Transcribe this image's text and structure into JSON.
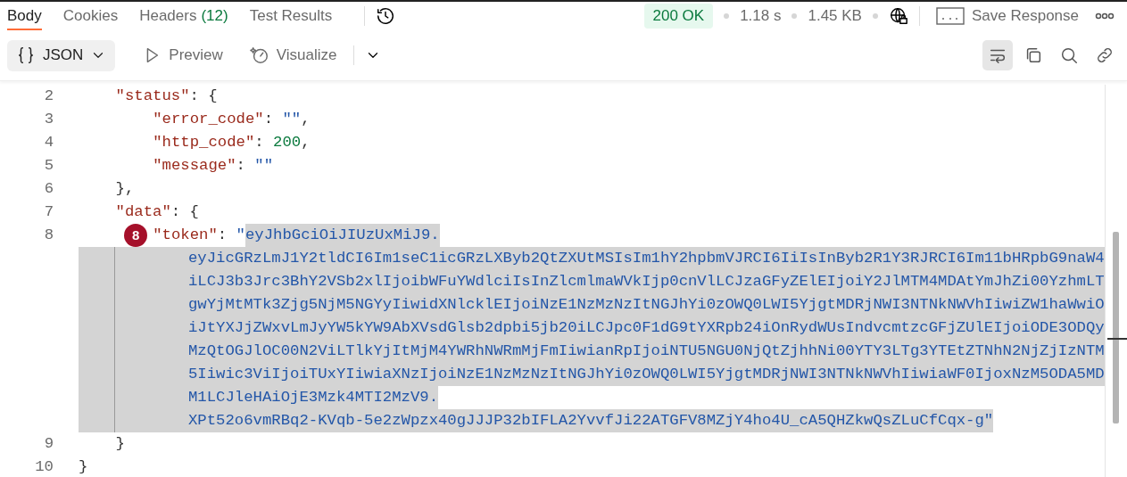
{
  "tabs": [
    {
      "label": "Body",
      "selected": true
    },
    {
      "label": "Cookies",
      "selected": false
    },
    {
      "label": "Headers",
      "count": "(12)",
      "selected": false
    },
    {
      "label": "Test Results",
      "selected": false
    }
  ],
  "response": {
    "status": "200 OK",
    "time": "1.18 s",
    "size": "1.45 KB",
    "save_label": "Save Response"
  },
  "view": {
    "format": "JSON",
    "modes": [
      "Preview",
      "Visualize"
    ],
    "wrap_on": true
  },
  "code": {
    "body": [
      {
        "number": "2",
        "segments": [
          {
            "kind": "key",
            "text": "\"status\""
          },
          {
            "kind": "punct",
            "text": ": {"
          }
        ],
        "children": [
          {
            "number": "3",
            "segments": [
              {
                "kind": "key",
                "text": "\"error_code\""
              },
              {
                "kind": "punct",
                "text": ": "
              },
              {
                "kind": "string",
                "text": "\"\""
              },
              {
                "kind": "punct",
                "text": ","
              }
            ]
          },
          {
            "number": "4",
            "segments": [
              {
                "kind": "key",
                "text": "\"http_code\""
              },
              {
                "kind": "punct",
                "text": ": "
              },
              {
                "kind": "number",
                "text": "200"
              },
              {
                "kind": "punct",
                "text": ","
              }
            ]
          },
          {
            "number": "5",
            "segments": [
              {
                "kind": "key",
                "text": "\"message\""
              },
              {
                "kind": "punct",
                "text": ": "
              },
              {
                "kind": "string",
                "text": "\"\""
              }
            ]
          }
        ]
      },
      {
        "number": "6",
        "segments": [
          {
            "kind": "punct",
            "text": "},"
          }
        ]
      },
      {
        "number": "7",
        "segments": [
          {
            "kind": "key",
            "text": "\"data\""
          },
          {
            "kind": "punct",
            "text": ": {"
          }
        ],
        "children": [
          {
            "number": "8",
            "marker": "8",
            "segments": [
              {
                "kind": "key",
                "text": "\"token\""
              },
              {
                "kind": "punct",
                "text": ": "
              },
              {
                "kind": "string",
                "text": "\""
              }
            ],
            "selection": [
              "eyJhbGciOiJIUzUxMiJ9.",
              "eyJicGRzLmJ1Y2tldCI6Im1seC1icGRzLXByb2QtZXUtMSIsIm1hY2hpbmVJRCI6IiIsInByb2R1Y3RJRCI6Im11bHRpbG9naW4",
              "iLCJ3b3Jrc3BhY2VSb2xlIjoibWFuYWdlciIsInZlcmlmaWVkIjp0cnVlLCJzaGFyZElEIjoiY2JlMTM4MDAtYmJhZi00YzhmLT",
              "gwYjMtMTk3Zjg5NjM5NGYyIiwidXNlcklEIjoiNzE1NzMzNzItNGJhYi0zOWQ0LWI5YjgtMDRjNWI3NTNkNWVhIiwiZW1haWwiO",
              "iJtYXJjZWxvLmJyYW5kYW9AbXVsdGlsb2dpbi5jb20iLCJpc0F1dG9tYXRpb24iOnRydWUsIndvcmtzcGFjZUlEIjoiODE3ODQy",
              "MzQtOGJlOC00N2ViLTlkYjItMjM4YWRhNWRmMjFmIiwianRpIjoiNTU5NGU0NjQtZjhhNi00YTY3LTg3YTEtZTNhN2NjZjIzNTM",
              "5Iiwic3ViIjoiTUxYIiwiaXNzIjoiNzE1NzMzNzItNGJhYi0zOWQ0LWI5YjgtMDRjNWI3NTNkNWVhIiwiaWF0IjoxNzM5ODA5MD",
              "M1LCJleHAiOjE3Mzk4MTI2MzV9.",
              "XPt52o6vmRBq2-KVqb-5e2zWpzx40gJJJP32bIFLA2YvvfJi22ATGFV8MZjY4ho4U_cA5QHZkwQsZLuCfCqx-g"
            ],
            "tail": "\""
          }
        ]
      },
      {
        "number": "9",
        "segments": [
          {
            "kind": "punct",
            "text": "}"
          }
        ]
      }
    ],
    "closing": {
      "number": "10",
      "segments": [
        {
          "kind": "punct",
          "text": "}"
        }
      ]
    }
  }
}
